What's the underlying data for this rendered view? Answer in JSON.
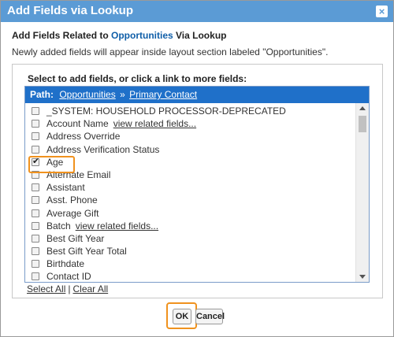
{
  "dialog": {
    "title": "Add Fields via Lookup",
    "close_glyph": "×",
    "heading_prefix": "Add Fields Related to ",
    "heading_object": "Opportunities",
    "heading_suffix": " Via Lookup",
    "subtext": "Newly added fields will appear inside layout section labeled \"Opportunities\"."
  },
  "panel": {
    "section_label": "Select to add fields, or click a link to more fields:",
    "path_label": "Path:",
    "path": [
      "Opportunities",
      "Primary Contact"
    ],
    "path_separator": "»",
    "items": [
      {
        "label": "_SYSTEM: HOUSEHOLD PROCESSOR-DEPRECATED",
        "checked": false,
        "link": ""
      },
      {
        "label": "Account Name",
        "checked": false,
        "link": "view related fields..."
      },
      {
        "label": "Address Override",
        "checked": false,
        "link": ""
      },
      {
        "label": "Address Verification Status",
        "checked": false,
        "link": ""
      },
      {
        "label": "Age",
        "checked": true,
        "link": ""
      },
      {
        "label": "Alternate Email",
        "checked": false,
        "link": ""
      },
      {
        "label": "Assistant",
        "checked": false,
        "link": ""
      },
      {
        "label": "Asst. Phone",
        "checked": false,
        "link": ""
      },
      {
        "label": "Average Gift",
        "checked": false,
        "link": ""
      },
      {
        "label": "Batch",
        "checked": false,
        "link": "view related fields..."
      },
      {
        "label": "Best Gift Year",
        "checked": false,
        "link": ""
      },
      {
        "label": "Best Gift Year Total",
        "checked": false,
        "link": ""
      },
      {
        "label": "Birthdate",
        "checked": false,
        "link": ""
      },
      {
        "label": "Contact ID",
        "checked": false,
        "link": ""
      }
    ],
    "select_all": "Select All",
    "select_sep": "|",
    "clear_all": "Clear All"
  },
  "buttons": {
    "ok": "OK",
    "cancel": "Cancel"
  },
  "colors": {
    "titlebar": "#5b9bd5",
    "pathbar": "#1f70c9",
    "highlight": "#f0921e",
    "link": "#0f5ea8"
  }
}
